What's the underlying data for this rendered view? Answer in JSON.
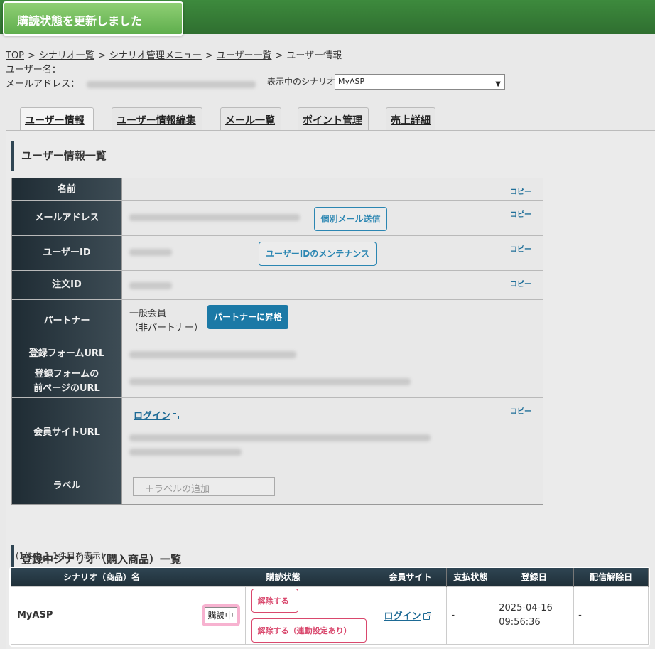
{
  "toast": {
    "message": "購読状態を更新しました"
  },
  "breadcrumb": [
    {
      "label": "TOP"
    },
    {
      "label": "シナリオ一覧"
    },
    {
      "label": "シナリオ管理メニュー"
    },
    {
      "label": "ユーザー一覧"
    },
    {
      "label": "ユーザー情報"
    }
  ],
  "breadcrumb_sep": ">",
  "meta": {
    "name_label": "ユーザー名：",
    "email_label": "メールアドレス：",
    "scenario_label": "表示中のシナリオ",
    "scenario_selected": "MyASP"
  },
  "tabs": [
    {
      "label": "ユーザー情報",
      "active": true
    },
    {
      "label": "ユーザー情報編集"
    },
    {
      "label": "メール一覧"
    },
    {
      "label": "ポイント管理"
    },
    {
      "label": "売上詳細"
    }
  ],
  "info_section": {
    "title": "ユーザー情報一覧",
    "copy_label": "コピー",
    "rows": {
      "name": "名前",
      "email": "メールアドレス",
      "user_id": "ユーザーID",
      "order_id": "注文ID",
      "partner": "パートナー",
      "form_url": "登録フォームURL",
      "form_prev_url": "登録フォームの\n前ページのURL",
      "member_url": "会員サイトURL",
      "label": "ラベル"
    },
    "email_button": "個別メール送信",
    "userid_button": "ユーザーIDのメンテナンス",
    "partner_status_line1": "一般会員",
    "partner_status_line2": "（非パートナー）",
    "partner_button": "パートナーに昇格",
    "login_link": "ログイン",
    "label_placeholder": "＋ラベルの追加"
  },
  "scenario_section": {
    "title": "登録中シナリオ（購入商品）一覧",
    "count_text": "(1件中 1-1件目を表示)",
    "columns": [
      "シナリオ（商品）名",
      "購読状態",
      "会員サイト",
      "支払状態",
      "登録日",
      "配信解除日"
    ],
    "rows": [
      {
        "name": "MyASP",
        "status": "購読中",
        "cancel_button": "解除する",
        "cancel_linked_button": "解除する（連動設定あり）",
        "member_site": "ログイン",
        "payment": "-",
        "registered_date": "2025-04-16",
        "registered_time": "09:56:36",
        "unsubscribed": "-"
      }
    ]
  },
  "colors": {
    "header_green": "#2f6f30",
    "toast_green": "#6fba5a",
    "table_header": "#2f4553",
    "link_blue": "#1d6a95",
    "status_highlight": "#f7b2d0",
    "danger": "#d9486d"
  }
}
